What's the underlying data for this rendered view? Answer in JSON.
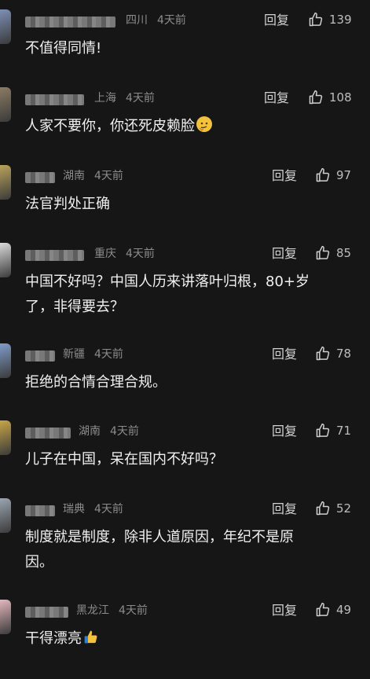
{
  "comments": [
    {
      "location": "四川",
      "time": "4天前",
      "reply": "回复",
      "likes": "139",
      "text": "不值得同情!",
      "avatar_color": "#7d8fb6"
    },
    {
      "location": "上海",
      "time": "4天前",
      "reply": "回复",
      "likes": "108",
      "text": "人家不要你，你还死皮赖脸",
      "emoji": "thinking-face",
      "avatar_color": "#8b7b63"
    },
    {
      "location": "湖南",
      "time": "4天前",
      "reply": "回复",
      "likes": "97",
      "text": "法官判处正确",
      "avatar_color": "#b9a35a"
    },
    {
      "location": "重庆",
      "time": "4天前",
      "reply": "回复",
      "likes": "85",
      "text": "中国不好吗？中国人历来讲落叶归根，80+岁\n了，非得要去？",
      "avatar_color": "#d9d9d9"
    },
    {
      "location": "新疆",
      "time": "4天前",
      "reply": "回复",
      "likes": "78",
      "text": "拒绝的合情合理合规。",
      "avatar_color": "#7f9cc9"
    },
    {
      "location": "湖南",
      "time": "4天前",
      "reply": "回复",
      "likes": "71",
      "text": "儿子在中国，呆在国内不好吗？",
      "avatar_color": "#c8a548"
    },
    {
      "location": "瑞典",
      "time": "4天前",
      "reply": "回复",
      "likes": "52",
      "text": "制度就是制度，除非人道原因，年纪不是原\n因。",
      "avatar_color": "#9aa4b0"
    },
    {
      "location": "黑龙江",
      "time": "4天前",
      "reply": "回复",
      "likes": "49",
      "text": "干得漂亮",
      "emoji": "thumbs-up",
      "avatar_color": "#e3b7bd"
    }
  ]
}
